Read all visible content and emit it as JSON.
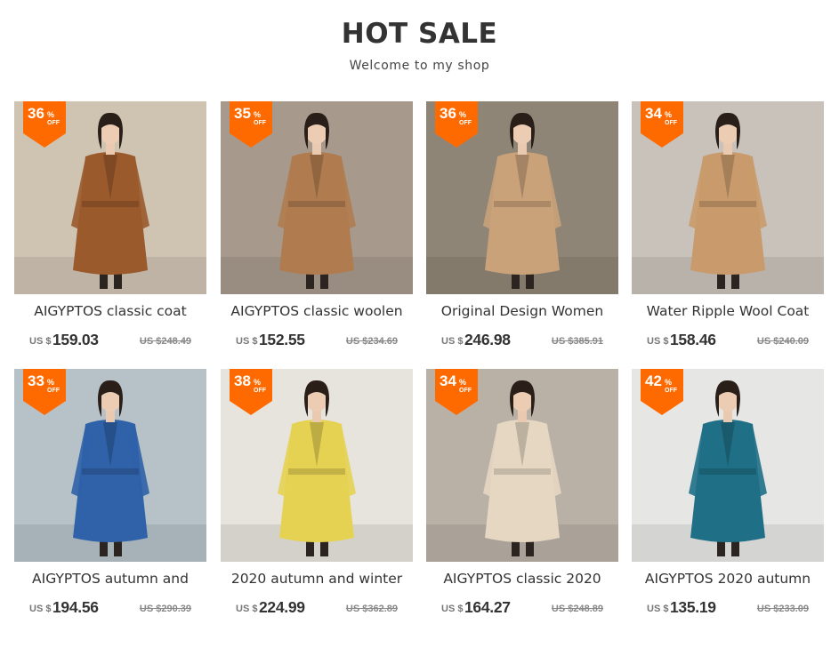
{
  "header": {
    "title": "HOT SALE",
    "subtitle": "Welcome to my shop"
  },
  "colors": {
    "badge": "#ff6a00",
    "text": "#333333",
    "old_price": "#888888"
  },
  "products": [
    {
      "discount": "36",
      "pct": "%",
      "off": "OFF",
      "name": "AIGYPTOS classic coat",
      "currency": "US $",
      "price": "159.03",
      "old_price": "US $248.49",
      "coat_color": "#9a5a2c",
      "bg": "#cfc3b2"
    },
    {
      "discount": "35",
      "pct": "%",
      "off": "OFF",
      "name": "AIGYPTOS classic woolen",
      "currency": "US $",
      "price": "152.55",
      "old_price": "US $234.69",
      "coat_color": "#b07c4f",
      "bg": "#a79a8c"
    },
    {
      "discount": "36",
      "pct": "%",
      "off": "OFF",
      "name": "Original Design Women",
      "currency": "US $",
      "price": "246.98",
      "old_price": "US $385.91",
      "coat_color": "#c9a27a",
      "bg": "#8f8576"
    },
    {
      "discount": "34",
      "pct": "%",
      "off": "OFF",
      "name": "Water Ripple Wool Coat",
      "currency": "US $",
      "price": "158.46",
      "old_price": "US $240.09",
      "coat_color": "#c99b6c",
      "bg": "#c8c2ba"
    },
    {
      "discount": "33",
      "pct": "%",
      "off": "OFF",
      "name": "AIGYPTOS autumn and",
      "currency": "US $",
      "price": "194.56",
      "old_price": "US $290.39",
      "coat_color": "#2f62a8",
      "bg": "#b6c2c8"
    },
    {
      "discount": "38",
      "pct": "%",
      "off": "OFF",
      "name": "2020 autumn and winter",
      "currency": "US $",
      "price": "224.99",
      "old_price": "US $362.89",
      "coat_color": "#e6d252",
      "bg": "#e7e3dd"
    },
    {
      "discount": "34",
      "pct": "%",
      "off": "OFF",
      "name": "AIGYPTOS classic 2020",
      "currency": "US $",
      "price": "164.27",
      "old_price": "US $248.89",
      "coat_color": "#e6d7c2",
      "bg": "#b9b0a6"
    },
    {
      "discount": "42",
      "pct": "%",
      "off": "OFF",
      "name": "AIGYPTOS 2020 autumn",
      "currency": "US $",
      "price": "135.19",
      "old_price": "US $233.09",
      "coat_color": "#1f6f86",
      "bg": "#e6e6e4"
    }
  ]
}
